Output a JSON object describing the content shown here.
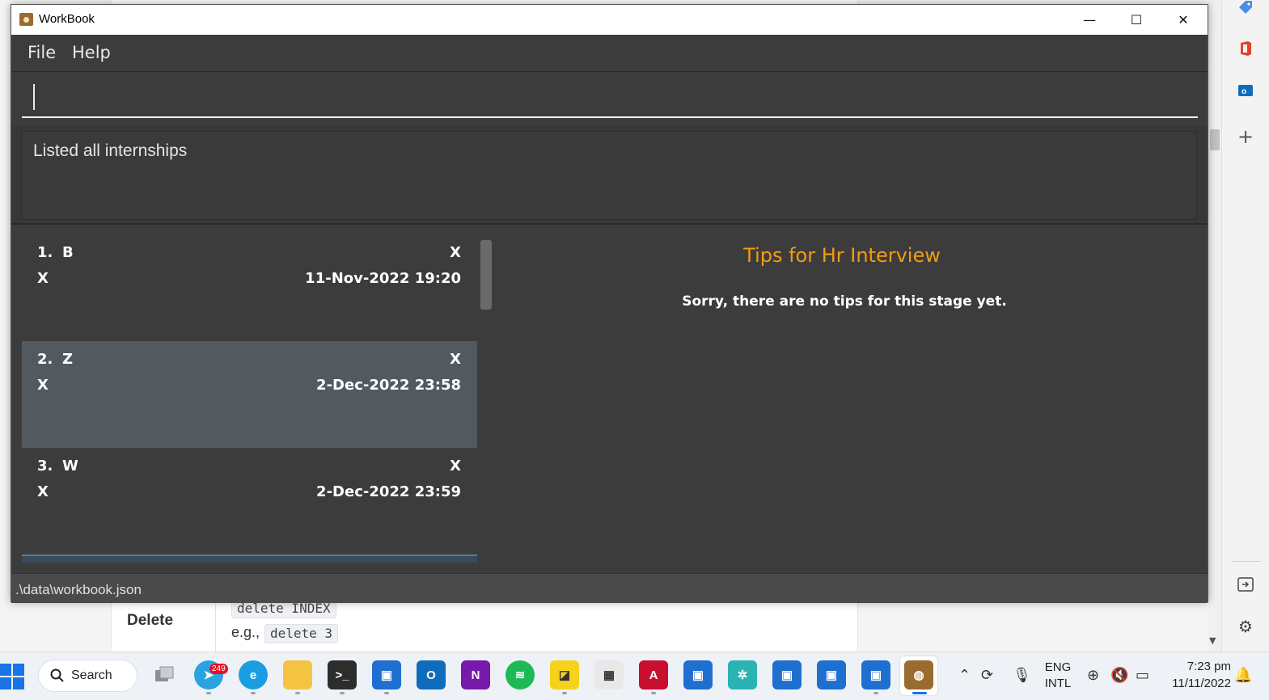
{
  "window": {
    "title": "WorkBook",
    "controls": {
      "minimize": "—",
      "maximize": "☐",
      "close": "✕"
    }
  },
  "menu": [
    "File",
    "Help"
  ],
  "command_box": {
    "value": "",
    "placeholder": ""
  },
  "result_message": "Listed all internships",
  "internships": [
    {
      "index": "1.",
      "company": "B",
      "stage": "X",
      "role": "X",
      "datetime": "11-Nov-2022 19:20",
      "selected": false
    },
    {
      "index": "2.",
      "company": "Z",
      "stage": "X",
      "role": "X",
      "datetime": "2-Dec-2022 23:58",
      "selected": true
    },
    {
      "index": "3.",
      "company": "W",
      "stage": "X",
      "role": "X",
      "datetime": "2-Dec-2022 23:59",
      "selected": false
    }
  ],
  "tips": {
    "title": "Tips for Hr Interview",
    "body": "Sorry, there are no tips for this stage yet."
  },
  "status_bar": {
    "file_path": ".\\data\\workbook.json"
  },
  "background_page": {
    "command_format": "delete INDEX",
    "row_label": "Delete",
    "example_prefix": "e.g.,",
    "example_command": "delete 3"
  },
  "taskbar": {
    "search_label": "Search",
    "telegram_badge": "249",
    "language": [
      "ENG",
      "INTL"
    ],
    "time": "7:23 pm",
    "date": "11/11/2022"
  },
  "colors": {
    "tips_title": "#f39c12",
    "window_bg": "#3c3c3c",
    "selected_card": "#525a60",
    "accent": "#1a73e8"
  }
}
